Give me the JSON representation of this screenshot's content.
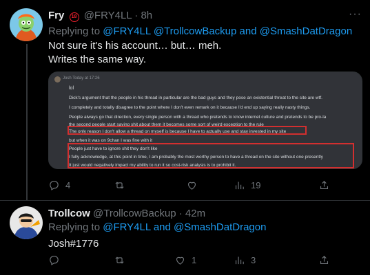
{
  "tweet1": {
    "display_name": "Fry",
    "badge": "18",
    "handle": "@FRY4LL",
    "time": "· 8h",
    "replying_prefix": "Replying to",
    "mentions": "@FRY4LL @TrollcowBackup and @SmashDatDragon",
    "line1": "Not sure it's his account… but… meh.",
    "line2": "Writes the same way.",
    "embed": {
      "header": "Josh   Today at 17:26",
      "messages": [
        "lol",
        "Dick's argument that the people in his thread in particular are the bad guys and they pose an existential threat to the site are wtf.",
        "I completely and totally disagree to the point where I don't even remark on it because I'd end up saying really nasty things.",
        "People always go that direction, every single person with a thread who pretends to know internet culture and pretends to be pro-la",
        "the second people start saying shit about them it becomes some sort of weird exception to the rule",
        "The only reason I don't allow a thread on myself is because I have to actually use and stay invested in my site",
        "but when it was on 9chan I was fine with it",
        "People just have to ignore shit they don't like",
        "I fully acknowledge, at this point in time, I am probably the most worthy person to have a thread on the site without one presently",
        "It just would negatively impact my ability to run it so cost-risk analysis is to prohibit it."
      ]
    },
    "stats": {
      "replies": "4",
      "retweets": "",
      "likes": "",
      "views": "19"
    }
  },
  "tweet2": {
    "display_name": "Trollcow",
    "handle": "@TrollcowBackup",
    "time": "· 42m",
    "replying_prefix": "Replying to",
    "mentions": "@FRY4LL and @SmashDatDragon",
    "text": "Josh#1776",
    "stats": {
      "replies": "",
      "retweets": "",
      "likes": "1",
      "views": "3"
    }
  },
  "colors": {
    "accent": "#1d9bf0",
    "muted": "#71767b",
    "highlight_box": "#d32f2f"
  }
}
